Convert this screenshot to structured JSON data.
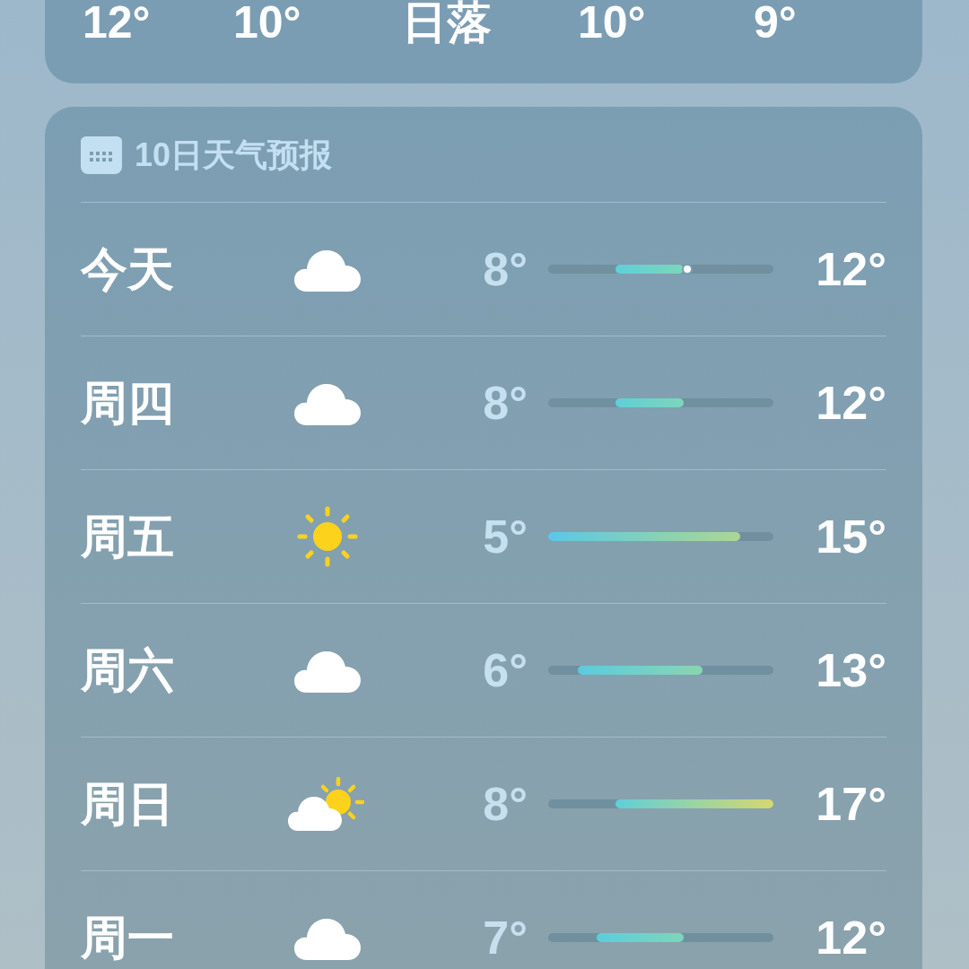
{
  "hourly_strip": {
    "items": [
      "12°",
      "10°",
      "日落",
      "10°",
      "9°"
    ]
  },
  "forecast": {
    "title": "10日天气预报",
    "days": [
      {
        "day": "今天",
        "kind": "cloudy",
        "low": "8°",
        "high": "12°",
        "now": true
      },
      {
        "day": "周四",
        "kind": "cloudy",
        "low": "8°",
        "high": "12°",
        "now": false
      },
      {
        "day": "周五",
        "kind": "sunny",
        "low": "5°",
        "high": "15°",
        "now": false
      },
      {
        "day": "周六",
        "kind": "cloudy",
        "low": "6°",
        "high": "13°",
        "now": false
      },
      {
        "day": "周日",
        "kind": "partly_sunny",
        "low": "8°",
        "high": "17°",
        "now": false
      },
      {
        "day": "周一",
        "kind": "cloudy",
        "low": "7°",
        "high": "12°",
        "now": false
      }
    ]
  }
}
